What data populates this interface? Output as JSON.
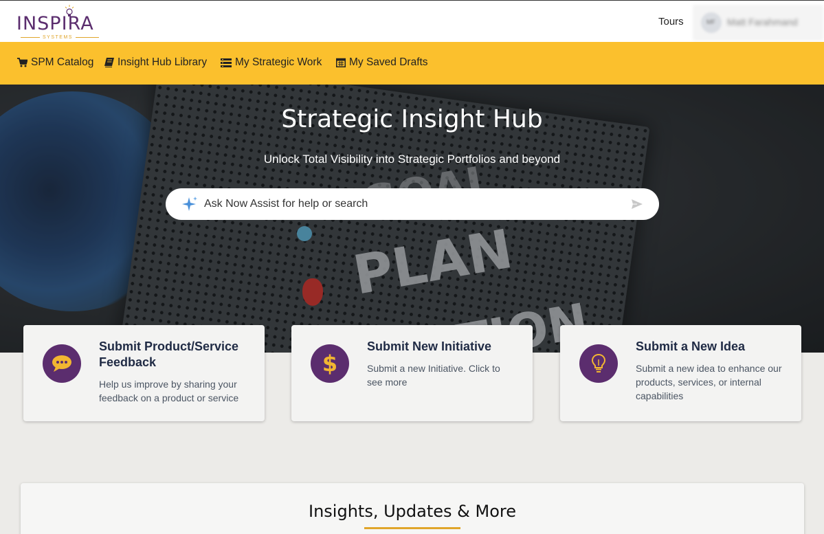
{
  "header": {
    "logo_text": "INSPIRA",
    "logo_subtext": "SYSTEMS",
    "tours_label": "Tours",
    "user": {
      "initials": "MF",
      "name": "Matt Farahmand"
    }
  },
  "nav": {
    "items": [
      {
        "label": "SPM Catalog",
        "icon": "cart-icon"
      },
      {
        "label": "Insight Hub Library",
        "icon": "book-icon"
      },
      {
        "label": "My Strategic Work",
        "icon": "list-icon"
      },
      {
        "label": "My Saved Drafts",
        "icon": "calendar-icon"
      }
    ]
  },
  "hero": {
    "title": "Strategic Insight Hub",
    "subtitle": "Unlock Total Visibility into Strategic Portfolios and beyond",
    "search": {
      "placeholder": "Ask Now Assist for help or search",
      "value": ""
    }
  },
  "cards": [
    {
      "title": "Submit Product/Service Feedback",
      "description": "Help us improve by sharing your feedback on a product or service",
      "icon": "chat-bubble-icon"
    },
    {
      "title": "Submit New Initiative",
      "description": "Submit a new Initiative. Click to see more",
      "icon": "dollar-icon"
    },
    {
      "title": "Submit a New Idea",
      "description": "Submit a new idea to enhance our products, services, or internal capabilities",
      "icon": "lightbulb-icon"
    }
  ],
  "insights": {
    "title": "Insights, Updates & More"
  },
  "colors": {
    "brand_purple": "#5b2d6e",
    "nav_yellow": "#fbc02d",
    "accent_gold": "#e0a52a",
    "card_title": "#1f2a44"
  }
}
